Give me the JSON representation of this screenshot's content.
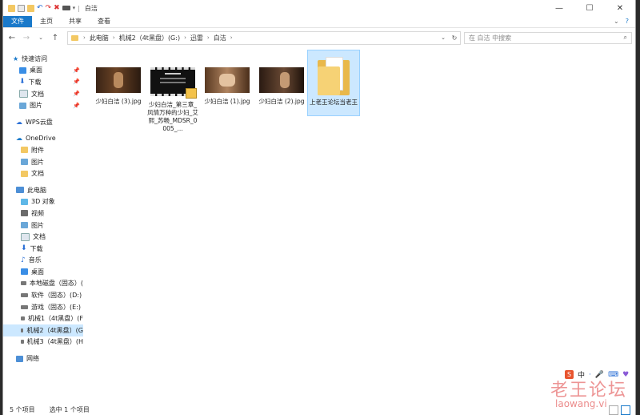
{
  "window": {
    "title": "白洁"
  },
  "ribbon": {
    "tabs": [
      "文件",
      "主页",
      "共享",
      "查看"
    ]
  },
  "address": {
    "crumbs": [
      "此电脑",
      "机械2（4t黑盘）(G:)",
      "迅雷",
      "白洁"
    ],
    "search_placeholder": "在 白洁 中搜索"
  },
  "nav": {
    "quick_access": {
      "label": "快速访问",
      "items": [
        "桌面",
        "下载",
        "文档",
        "图片"
      ]
    },
    "wps": "WPS云盘",
    "onedrive": {
      "label": "OneDrive",
      "items": [
        "附件",
        "图片",
        "文档"
      ]
    },
    "this_pc": {
      "label": "此电脑",
      "items": [
        "3D 对象",
        "视频",
        "图片",
        "文档",
        "下载",
        "音乐",
        "桌面"
      ],
      "drives": [
        "本地磁盘（固态）(",
        "软件（固态）(D:)",
        "游戏（固态）(E:)",
        "机械1（4t黑盘）(F",
        "机械2（4t黑盘）(G",
        "机械3（4t黑盘）(H"
      ]
    },
    "network": "网络"
  },
  "files": [
    {
      "name": "少妇白洁 (3).jpg",
      "kind": "image"
    },
    {
      "name": "少妇白洁_第三章_风情万种的少妇_艾熙_苏畅_MDSR_0005_...",
      "kind": "video"
    },
    {
      "name": "少妇白洁 (1).jpg",
      "kind": "image"
    },
    {
      "name": "少妇白洁 (2).jpg",
      "kind": "image"
    },
    {
      "name": "上老王论坛当老王",
      "kind": "folder"
    }
  ],
  "status": {
    "count": "5 个项目",
    "selected": "选中 1 个项目"
  },
  "ime": {
    "lang": "中"
  },
  "watermark": {
    "cn": "老王论坛",
    "en": "laowang.vi"
  },
  "colors": {
    "accent": "#1979ca",
    "selection": "#cce8ff",
    "folder": "#f3c863"
  }
}
